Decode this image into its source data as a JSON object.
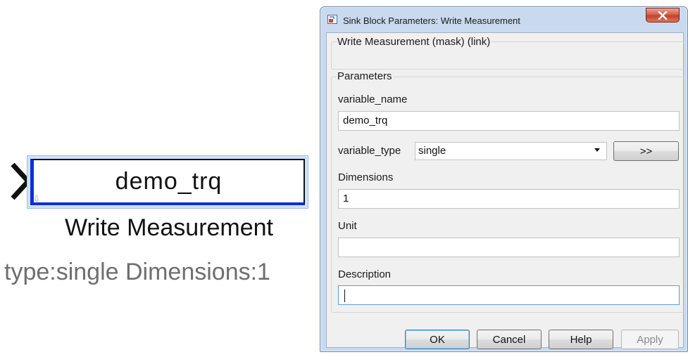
{
  "canvas": {
    "block_value": "demo_trq",
    "block_name": "Write Measurement",
    "block_annotation": "type:single Dimensions:1"
  },
  "dialog": {
    "title": "Sink Block Parameters: Write Measurement",
    "close_icon": "close-icon",
    "mask_group_title": "Write Measurement (mask) (link)",
    "parameters_group_title": "Parameters",
    "variable_name": {
      "label": "variable_name",
      "value": "demo_trq"
    },
    "variable_type": {
      "label": "variable_type",
      "value": "single",
      "edit_label": ">>"
    },
    "dimensions": {
      "label": "Dimensions",
      "value": "1"
    },
    "unit": {
      "label": "Unit",
      "value": ""
    },
    "description": {
      "label": "Description",
      "value": ""
    },
    "buttons": {
      "ok": "OK",
      "cancel": "Cancel",
      "help": "Help",
      "apply": "Apply"
    }
  },
  "colors": {
    "block_port_accent": "#0b2fd6",
    "block_selection": "#cfe3ff",
    "dialog_frame": "#c9daef",
    "close_button": "#c2412b"
  }
}
